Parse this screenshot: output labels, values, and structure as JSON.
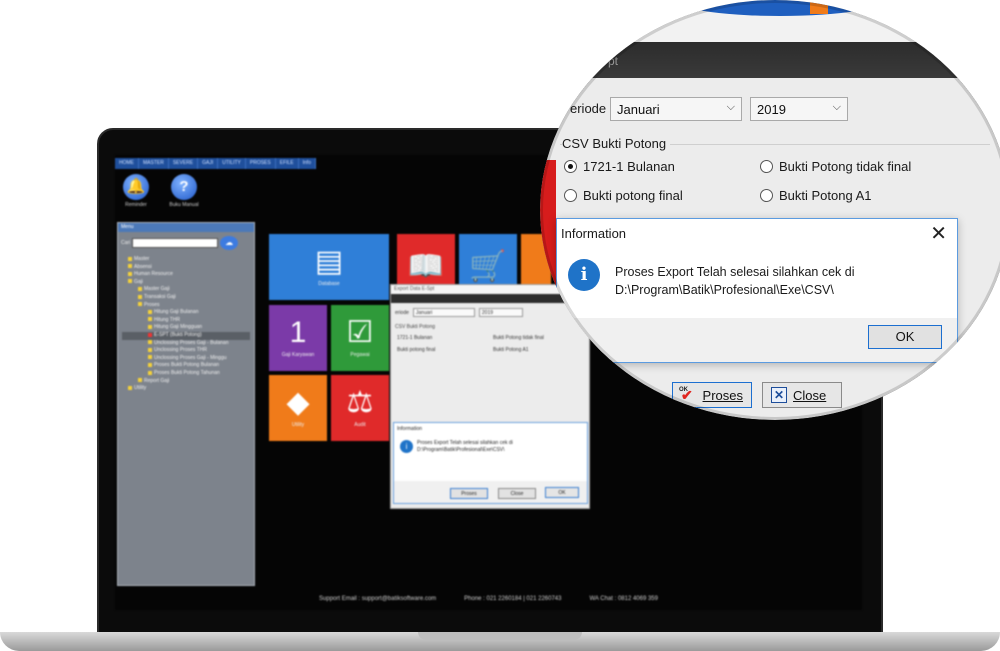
{
  "app": {
    "menu": [
      "HOME",
      "MASTER",
      "SEVERE",
      "GAJI",
      "UTILITY",
      "PROSES",
      "EFILE",
      "Info"
    ],
    "top_icons": [
      {
        "icon": "bell-icon",
        "label": "Reminder"
      },
      {
        "icon": "question-icon",
        "label": "Buku Manual"
      }
    ],
    "sidebar": {
      "title": "Menu",
      "search_label": "Cari",
      "items": [
        "Master",
        "Absensi",
        "Human Resource",
        "Gaji",
        "Master Gaji",
        "Transaksi Gaji",
        "Proses",
        "Hitung Gaji Bulanan",
        "Hitung THR",
        "Hitung Gaji Mingguan",
        "E-SPT (Bukti Potong)",
        "Unclossing Proses Gaji - Bulanan",
        "Unclossing Proses THR",
        "Unclossing Proses Gaji - Minggu",
        "Proses Bukti Potong Bulanan",
        "Proses Bukti Potong Tahunan",
        "Report Gaji",
        "Utility"
      ]
    },
    "tiles": [
      {
        "name": "tile-database",
        "label": "Database",
        "glyph": "▤",
        "color": "#2f7fd8"
      },
      {
        "name": "tile-book",
        "label": "",
        "glyph": "📖",
        "color": "#e02a2a"
      },
      {
        "name": "tile-cart",
        "label": "",
        "glyph": "🛒",
        "color": "#2f7fd8"
      },
      {
        "name": "tile-gaji-karyawan",
        "label": "Gaji Karyawan",
        "glyph": "1",
        "color": "#7b3aa8"
      },
      {
        "name": "tile-pegawai",
        "label": "Pegawai",
        "glyph": "☑",
        "color": "#2f9a3a"
      },
      {
        "name": "tile-utility",
        "label": "Utility",
        "glyph": "◆",
        "color": "#f07b1a"
      },
      {
        "name": "tile-audit",
        "label": "Audit",
        "glyph": "⚖",
        "color": "#e02a2a"
      }
    ],
    "footer": {
      "support_email": "Support Email :  support@batiksoftware.com",
      "phone": "Phone : 021 2260184 | 021 2260743",
      "wa_chat": "WA Chat : 0812 4069 359"
    }
  },
  "dialog": {
    "window_title": "Export Data E-Spt",
    "title_fragment": "pt",
    "periode_label": "eriode",
    "month_value": "Januari",
    "year_value": "2019",
    "group_title": "CSV Bukti Potong",
    "options": [
      {
        "label": "1721-1 Bulanan",
        "checked": true
      },
      {
        "label": "Bukti Potong tidak final",
        "checked": false
      },
      {
        "label": "Bukti potong final",
        "checked": false
      },
      {
        "label": "Bukti Potong A1",
        "checked": false
      }
    ],
    "proses_label": "Proses",
    "proses_icon_text": "OK",
    "close_label": "Close"
  },
  "info": {
    "title": "Information",
    "close_glyph": "✕",
    "icon_glyph": "i",
    "message_line1": "Proses Export Telah selesai silahkan cek di",
    "message_line2": "D:\\Program\\Batik\\Profesional\\Exe\\CSV\\",
    "ok_label": "OK"
  },
  "colors": {
    "accent_blue": "#1c6fd0",
    "tile_red": "#e02a2a",
    "tile_orange": "#f07b1a",
    "info_icon": "#1f73c8"
  }
}
